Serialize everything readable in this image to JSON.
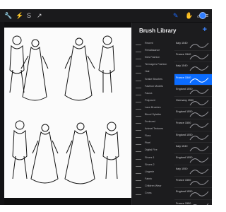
{
  "app": {
    "panel_title": "Brush Library",
    "add_icon": "plus-icon"
  },
  "toolbar": {
    "left_icons": [
      "wrench-icon",
      "magic-wand-icon",
      "selection-icon",
      "transform-icon"
    ],
    "right_icons": [
      "brush-icon",
      "smudge-icon",
      "eraser-icon",
      "layers-icon",
      "color-icon"
    ]
  },
  "categories": [
    {
      "label": "Recent",
      "selected": false
    },
    {
      "label": "Renaissance",
      "selected": false
    },
    {
      "label": "Kids Fashion",
      "selected": false
    },
    {
      "label": "Teenagers Fashion",
      "selected": false
    },
    {
      "label": "Hair",
      "selected": false
    },
    {
      "label": "Snake Brushes",
      "selected": false
    },
    {
      "label": "Fashion Models",
      "selected": false
    },
    {
      "label": "Fauna",
      "selected": false
    },
    {
      "label": "Potpourri",
      "selected": false
    },
    {
      "label": "Lace Brushes",
      "selected": false
    },
    {
      "label": "Blood Splatter",
      "selected": false
    },
    {
      "label": "Sunburst",
      "selected": false
    },
    {
      "label": "Animal Textures",
      "selected": false
    },
    {
      "label": "Flora",
      "selected": false
    },
    {
      "label": "Pixel",
      "selected": false
    },
    {
      "label": "Digital Fire",
      "selected": false
    },
    {
      "label": "Shoes 1",
      "selected": false
    },
    {
      "label": "Shoes 2",
      "selected": false
    },
    {
      "label": "Lingerie",
      "selected": false
    },
    {
      "label": "Fabric",
      "selected": false
    },
    {
      "label": "Children Wear",
      "selected": false
    },
    {
      "label": "Cross",
      "selected": false
    }
  ],
  "brushes": [
    {
      "label": "Italy 1540",
      "selected": false
    },
    {
      "label": "France 1540",
      "selected": false
    },
    {
      "label": "Italy 1540",
      "selected": false
    },
    {
      "label": "France 1540",
      "selected": true
    },
    {
      "label": "England 1550",
      "selected": false
    },
    {
      "label": "Germany 1550",
      "selected": false
    },
    {
      "label": "England 1550",
      "selected": false
    },
    {
      "label": "France 1550",
      "selected": false
    },
    {
      "label": "England 1550",
      "selected": false
    },
    {
      "label": "Italy 1540",
      "selected": false
    },
    {
      "label": "England 1550",
      "selected": false
    },
    {
      "label": "Italy 1550",
      "selected": false
    },
    {
      "label": "France 1550",
      "selected": false
    },
    {
      "label": "England 1550",
      "selected": false
    },
    {
      "label": "France 1550",
      "selected": false
    },
    {
      "label": "England 1550",
      "selected": false
    }
  ],
  "colors": {
    "accent": "#0b6cff",
    "panel_bg": "#1c1c1e",
    "topbar_bg": "#1a1a1c",
    "canvas_bg": "#fbfbfb"
  }
}
